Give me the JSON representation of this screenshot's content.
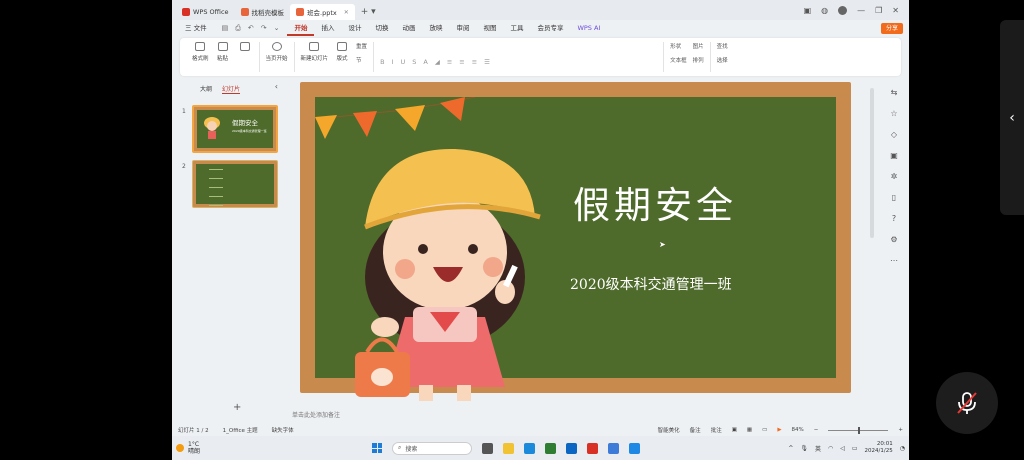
{
  "window": {
    "tabs": [
      {
        "label": "WPS Office",
        "icon": "wps-icon"
      },
      {
        "label": "找稻壳模板",
        "icon": "template-icon"
      },
      {
        "label": "班会.pptx",
        "icon": "ppt-icon",
        "active": true
      }
    ]
  },
  "menu": {
    "file": "三 文件",
    "items": [
      "开始",
      "插入",
      "设计",
      "切换",
      "动画",
      "放映",
      "审阅",
      "视图",
      "工具",
      "会员专享"
    ],
    "active": "开始",
    "wps_ai": "WPS AI",
    "share": "分享"
  },
  "ribbon": {
    "format_painter": "格式刷",
    "paste": "粘贴",
    "start_from_current": "当页开始",
    "new_slide": "新建幻灯片",
    "layout": "版式",
    "section": "节",
    "reset": "重置",
    "shape": "形状",
    "textbox": "文本框",
    "picture": "图片",
    "arrange": "排列",
    "find": "查找",
    "select": "选择"
  },
  "panel": {
    "outline_tab": "大纲",
    "slides_tab": "幻灯片",
    "thumb1_title": "假期安全",
    "slide_numbers": [
      "1",
      "2"
    ]
  },
  "slide": {
    "title": "假期安全",
    "subtitle": "2020级本科交通管理一班",
    "board_color": "#4e6b2b",
    "frame_color": "#c98a4d"
  },
  "notes_placeholder": "单击此处添加备注",
  "status": {
    "slide_count": "幻灯片 1 / 2",
    "theme": "1_Office 主题",
    "missing_font": "缺失字体",
    "smart_beautify": "智能美化",
    "notes": "备注",
    "comments": "批注",
    "zoom": "84%"
  },
  "taskbar": {
    "temperature": "1°C",
    "weather": "晴朗",
    "search_placeholder": "搜索",
    "ime": "英",
    "time": "20:01",
    "date": "2024/1/25"
  }
}
